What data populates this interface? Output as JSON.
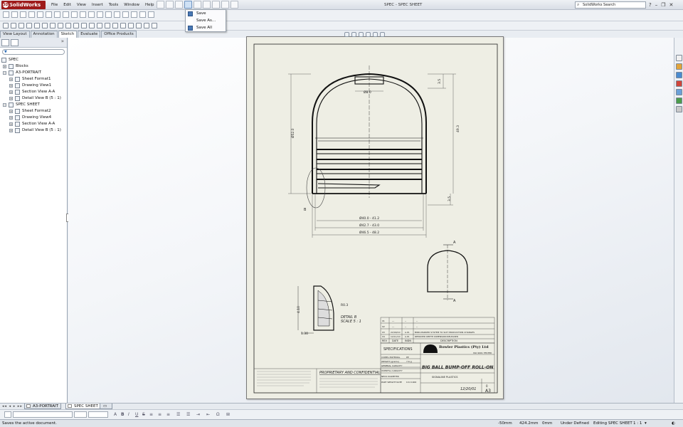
{
  "app": {
    "logo": "SolidWorks",
    "window_title": "SPEC - SPEC SHEET"
  },
  "menus": [
    "File",
    "Edit",
    "View",
    "Insert",
    "Tools",
    "Window",
    "Help"
  ],
  "search": {
    "value": "SolidWorks Search"
  },
  "save_menu": {
    "items": [
      "Save",
      "Save As...",
      "Save All"
    ]
  },
  "command_tabs": [
    "View Layout",
    "Annotation",
    "Sketch",
    "Evaluate",
    "Office Products"
  ],
  "command_tabs_active": "Sketch",
  "tree": {
    "items": [
      {
        "label": "SPEC",
        "level": 0
      },
      {
        "label": "Blocks",
        "level": 1
      },
      {
        "label": "A3-PORTRAIT",
        "level": 1
      },
      {
        "label": "Sheet Format1",
        "level": 2
      },
      {
        "label": "Drawing View1",
        "level": 2
      },
      {
        "label": "Section View A-A",
        "level": 2
      },
      {
        "label": "Detail View B (5 : 1)",
        "level": 2
      },
      {
        "label": "SPEC SHEET",
        "level": 1
      },
      {
        "label": "Sheet Format2",
        "level": 2
      },
      {
        "label": "Drawing View4",
        "level": 2
      },
      {
        "label": "Section View A-A",
        "level": 2
      },
      {
        "label": "Detail View B (5 : 1)",
        "level": 2
      }
    ]
  },
  "drawing": {
    "dims": {
      "top_width": "Ø8.0",
      "top_right": "3.5",
      "left_height": "Ø52.0",
      "right_height": "49.3",
      "bottom_right": "3.5",
      "dim1": "Ø40.0 - 41.2",
      "dim2": "Ø42.7 - 43.0",
      "dim3": "Ø46.5 - 48.2",
      "detail_r": "R0.3",
      "detail_h": "4.10",
      "detail_w": "1.30"
    },
    "detail_ref": "B",
    "section_letter": "A",
    "detail_caption_1": "DETAIL B",
    "detail_caption_2": "SCALE 5 : 1",
    "rev_header": [
      "REV",
      "DATE",
      "INDN",
      "DESCRIPTION"
    ],
    "rev_rows": [
      [
        "01",
        "---",
        "--",
        "--"
      ],
      [
        "02",
        "---",
        "--",
        "--"
      ],
      [
        "03",
        "22/09/10",
        "A.W.",
        "BIRD-MARKED SYSTEM TO SUIT PRODUCTION CHANGES"
      ],
      [
        "04",
        "12/11/10",
        "A.W.",
        "REMOVED DEPTH DIMENSION RELEASED"
      ]
    ],
    "title_block": {
      "specifications": "SPECIFICATIONS",
      "company": "Bowler Plastics (Pty) Ltd",
      "iso": "ISO 9001 TESTED",
      "title": "BIG BALL BUMP-OFF ROLL-ON",
      "customer": "SIGNALINE PLASTICS",
      "proprietary": "PROPRIETARY AND CONFIDENTIAL",
      "date": "12/20/01",
      "rev": "0",
      "size": "A3"
    },
    "spec_labels": [
      "COMPL MATERIAL",
      "WEIGHT (grams)",
      "GENERAL CAPACITY",
      "OVERFILL CAPACITY",
      "NECK DIAMETER",
      "PART WEIGHT RATE"
    ],
    "spec_values": [
      "PP",
      "7.6 g",
      "",
      "",
      "",
      "0.6 0.900"
    ]
  },
  "sheet_tabs": [
    "A3-PORTRAIT",
    "SPEC SHEET"
  ],
  "sheet_tab_active": "SPEC SHEET",
  "status": {
    "message": "Saves the active document.",
    "x": "-50mm",
    "y": "424.2mm",
    "z": "0mm",
    "state": "Under Defined",
    "editing": "Editing SPEC SHEET",
    "scale": "1 : 1"
  }
}
